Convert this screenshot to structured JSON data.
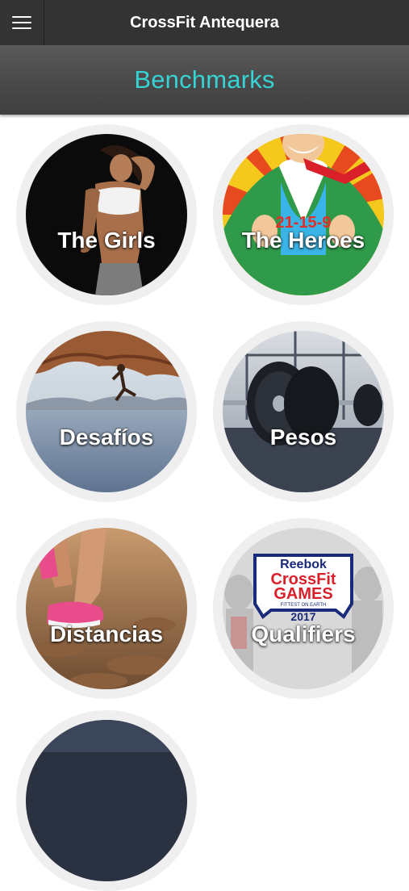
{
  "app": {
    "title": "CrossFit Antequera"
  },
  "header": {
    "menu_icon": "hamburger-menu-icon"
  },
  "section": {
    "title": "Benchmarks",
    "title_color": "#37d3d3"
  },
  "tiles": [
    {
      "label": "The Girls"
    },
    {
      "label": "The Heroes",
      "badge": "21-15-9"
    },
    {
      "label": "Desafíos"
    },
    {
      "label": "Pesos"
    },
    {
      "label": "Distancias"
    },
    {
      "label": "Qualifiers",
      "logo_lines": [
        "Reebok",
        "CrossFit",
        "GAMES",
        "FITTEST ON EARTH",
        "2017"
      ]
    },
    {
      "label": ""
    }
  ]
}
